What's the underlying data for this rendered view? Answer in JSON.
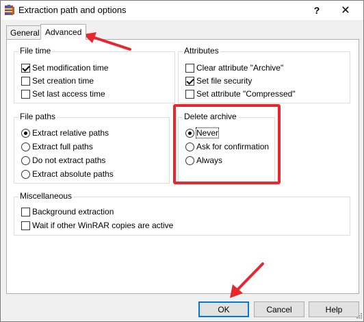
{
  "window": {
    "title": "Extraction path and options",
    "help_glyph": "?",
    "close_glyph": "✕",
    "icon": "winrar-books-icon"
  },
  "tabs": [
    {
      "label": "General",
      "active": false
    },
    {
      "label": "Advanced",
      "active": true
    }
  ],
  "file_time": {
    "title": "File time",
    "options": [
      {
        "label": "Set modification time",
        "checked": true
      },
      {
        "label": "Set creation time",
        "checked": false
      },
      {
        "label": "Set last access time",
        "checked": false
      }
    ]
  },
  "attributes": {
    "title": "Attributes",
    "options": [
      {
        "label": "Clear attribute \"Archive\"",
        "checked": false
      },
      {
        "label": "Set file security",
        "checked": true
      },
      {
        "label": "Set attribute \"Compressed\"",
        "checked": false
      }
    ]
  },
  "file_paths": {
    "title": "File paths",
    "options": [
      {
        "label": "Extract relative paths",
        "selected": true
      },
      {
        "label": "Extract full paths",
        "selected": false
      },
      {
        "label": "Do not extract paths",
        "selected": false
      },
      {
        "label": "Extract absolute paths",
        "selected": false
      }
    ]
  },
  "delete_archive": {
    "title": "Delete archive",
    "options": [
      {
        "label": "Never",
        "selected": true
      },
      {
        "label": "Ask for confirmation",
        "selected": false
      },
      {
        "label": "Always",
        "selected": false
      }
    ]
  },
  "miscellaneous": {
    "title": "Miscellaneous",
    "options": [
      {
        "label": "Background extraction",
        "checked": false
      },
      {
        "label": "Wait if other WinRAR copies are active",
        "checked": false
      }
    ]
  },
  "buttons": {
    "ok": "OK",
    "cancel": "Cancel",
    "help": "Help"
  },
  "annotations": {
    "color": "#e8262e"
  }
}
